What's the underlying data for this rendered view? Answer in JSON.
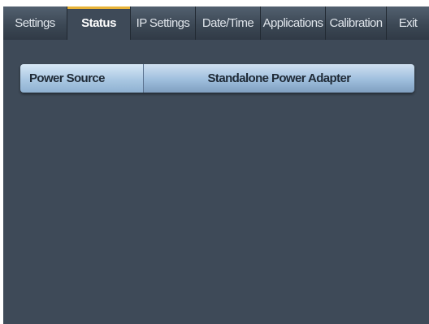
{
  "tabs": [
    {
      "label": "Settings"
    },
    {
      "label": "Status"
    },
    {
      "label": "IP Settings"
    },
    {
      "label": "Date/Time"
    },
    {
      "label": "Applications"
    },
    {
      "label": "Calibration"
    },
    {
      "label": "Exit"
    }
  ],
  "active_tab": "Status",
  "status": {
    "power_source_label": "Power Source",
    "power_source_value": "Standalone Power Adapter"
  },
  "colors": {
    "accent": "#e8b339",
    "background": "#3e4a58"
  }
}
